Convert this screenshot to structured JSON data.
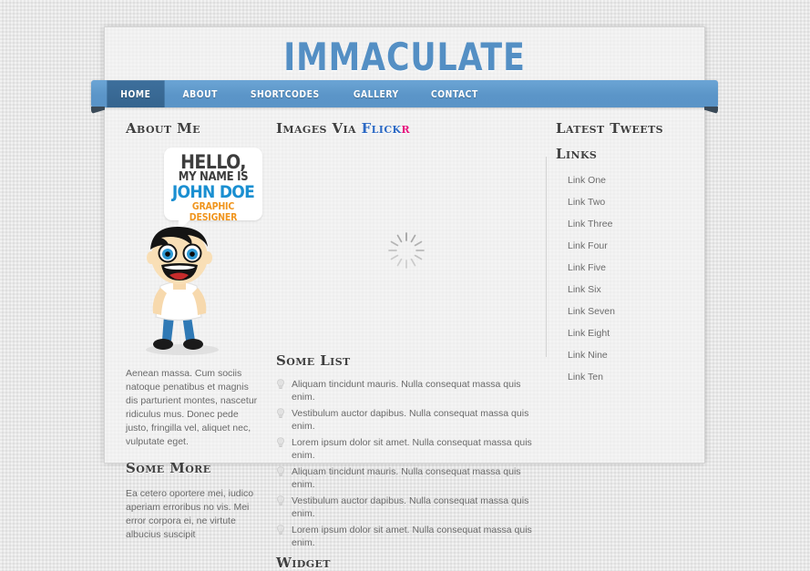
{
  "site": {
    "title": "IMMACULATE"
  },
  "nav": {
    "items": [
      {
        "label": "HOME",
        "active": true
      },
      {
        "label": "ABOUT",
        "active": false
      },
      {
        "label": "SHORTCODES",
        "active": false
      },
      {
        "label": "GALLERY",
        "active": false
      },
      {
        "label": "CONTACT",
        "active": false
      }
    ]
  },
  "colors": {
    "brand_blue": "#548fc4",
    "nav_blue": "#5b95c8",
    "nav_active_blue": "#3d6f9c",
    "ribbon_fold": "#3a4a58",
    "flickr_blue": "#2c69c4",
    "flickr_pink": "#e6157e",
    "bubble_name_blue": "#1a8fd1",
    "bubble_role_orange": "#f0951e",
    "page_bg": "#f1f1f1",
    "body_bg": "#e8e8e8",
    "heading_text": "#3f3f3f",
    "body_text": "#6a6a6a"
  },
  "left_column": {
    "about": {
      "heading": "About Me",
      "bubble": {
        "line1": "HELLO,",
        "line2": "MY NAME IS",
        "line3": "JOHN DOE",
        "line4": "GRAPHIC DESIGNER"
      },
      "avatar_icon": "cartoon-character-avatar",
      "text": "Aenean massa. Cum sociis natoque penatibus et magnis dis parturient montes, nascetur ridiculus mus. Donec pede justo, fringilla vel, aliquet nec, vulputate eget."
    },
    "some_more": {
      "heading": "Some More",
      "text": "Ea cetero oportere mei, iudico aperiam erroribus no vis. Mei error corpora ei, ne virtute albucius suscipit"
    }
  },
  "center_column": {
    "flickr": {
      "heading_prefix": "Images Via ",
      "heading_brand_blue": "Flick",
      "heading_brand_pink": "r",
      "loading_icon": "radial-spinner-loading-icon"
    },
    "some_list": {
      "heading": "Some List",
      "bullet_icon": "lightbulb-icon",
      "items": [
        "Aliquam tincidunt mauris. Nulla consequat massa quis enim.",
        "Vestibulum auctor dapibus. Nulla consequat massa quis enim.",
        "Lorem ipsum dolor sit amet. Nulla consequat massa quis enim.",
        "Aliquam tincidunt mauris. Nulla consequat massa quis enim.",
        "Vestibulum auctor dapibus. Nulla consequat massa quis enim.",
        "Lorem ipsum dolor sit amet. Nulla consequat massa quis enim."
      ]
    },
    "widget": {
      "heading": "Widget"
    }
  },
  "right_column": {
    "latest_tweets": {
      "heading": "Latest Tweets"
    },
    "links": {
      "heading": "Links",
      "items": [
        "Link One",
        "Link Two",
        "Link Three",
        "Link Four",
        "Link Five",
        "Link Six",
        "Link Seven",
        "Link Eight",
        "Link Nine",
        "Link Ten"
      ]
    }
  }
}
